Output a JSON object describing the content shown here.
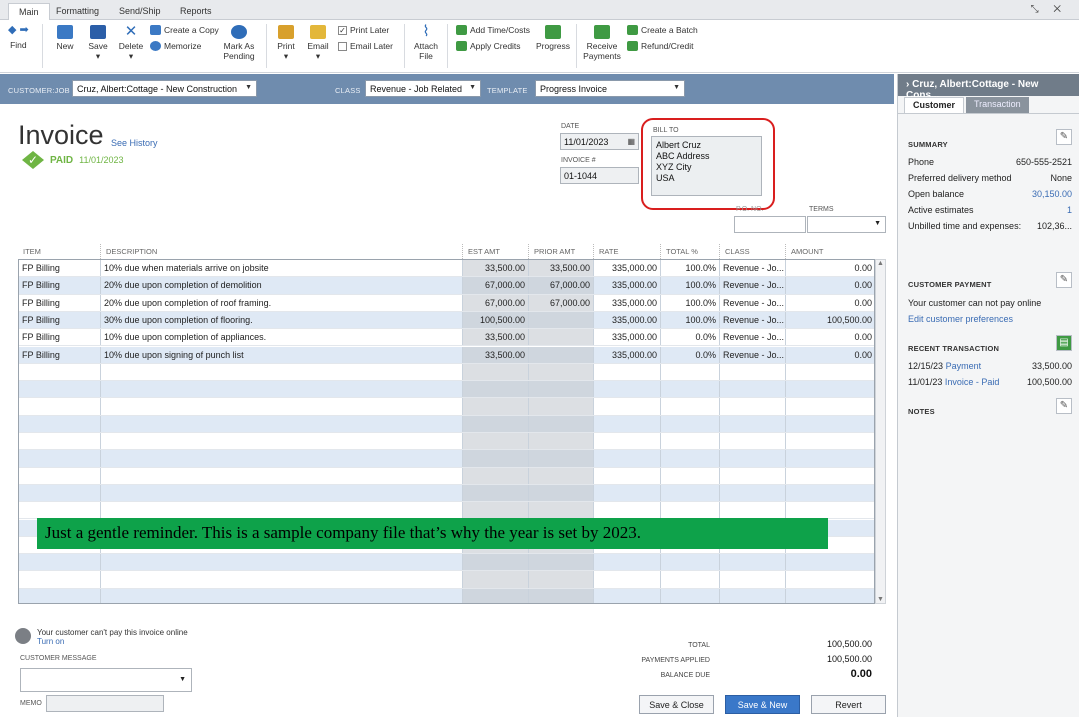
{
  "menu_tabs": [
    "Main",
    "Formatting",
    "Send/Ship",
    "Reports"
  ],
  "window_controls": "⤡ ✕",
  "toolbar": {
    "find": "Find",
    "new": "New",
    "save": "Save",
    "delete": "Delete",
    "create_copy": "Create a Copy",
    "memorize": "Memorize",
    "mark_pending": "Mark As Pending",
    "print": "Print",
    "email": "Email",
    "print_later": "Print Later",
    "email_later": "Email Later",
    "attach_file": "Attach File",
    "add_time_costs": "Add Time/Costs",
    "apply_credits": "Apply Credits",
    "progress": "Progress",
    "receive_payments": "Receive Payments",
    "create_batch": "Create a Batch",
    "refund_credit": "Refund/Credit"
  },
  "header": {
    "customer_job_label": "CUSTOMER:JOB",
    "customer_job": "Cruz, Albert:Cottage - New Construction",
    "class_label": "CLASS",
    "class": "Revenue - Job Related",
    "template_label": "TEMPLATE",
    "template": "Progress Invoice"
  },
  "invoice": {
    "title": "Invoice",
    "see_history": "See History",
    "paid_label": "PAID",
    "paid_date": "11/01/2023",
    "date_label": "DATE",
    "date": "11/01/2023",
    "invoice_no_label": "INVOICE #",
    "invoice_no": "01-1044",
    "bill_to_label": "BILL TO",
    "bill_to": [
      "Albert Cruz",
      "ABC Address",
      "XYZ City",
      "USA"
    ],
    "po_label": "P.O. NO.",
    "terms_label": "TERMS"
  },
  "grid": {
    "headers": [
      "ITEM",
      "DESCRIPTION",
      "EST AMT",
      "PRIOR AMT",
      "RATE",
      "TOTAL %",
      "CLASS",
      "AMOUNT"
    ],
    "rows": [
      [
        "FP Billing",
        "10% due when materials arrive on jobsite",
        "33,500.00",
        "33,500.00",
        "335,000.00",
        "100.0%",
        "Revenue - Jo...",
        "0.00"
      ],
      [
        "FP Billing",
        "20% due upon completion of demolition",
        "67,000.00",
        "67,000.00",
        "335,000.00",
        "100.0%",
        "Revenue - Jo...",
        "0.00"
      ],
      [
        "FP Billing",
        "20% due upon completion of roof framing.",
        "67,000.00",
        "67,000.00",
        "335,000.00",
        "100.0%",
        "Revenue - Jo...",
        "0.00"
      ],
      [
        "FP Billing",
        "30% due upon completion of flooring.",
        "100,500.00",
        "",
        "335,000.00",
        "100.0%",
        "Revenue - Jo...",
        "100,500.00"
      ],
      [
        "FP Billing",
        "10% due upon completion of appliances.",
        "33,500.00",
        "",
        "335,000.00",
        "0.0%",
        "Revenue - Jo...",
        "0.00"
      ],
      [
        "FP Billing",
        "10% due upon signing of punch list",
        "33,500.00",
        "",
        "335,000.00",
        "0.0%",
        "Revenue - Jo...",
        "0.00"
      ]
    ]
  },
  "note": "Just a gentle reminder. This is a sample company file that’s why the year is set by 2023.",
  "bottom": {
    "online_text": "Your customer can't pay this invoice online",
    "turn_on": "Turn on",
    "customer_message_label": "CUSTOMER MESSAGE",
    "memo_label": "MEMO",
    "total_label": "TOTAL",
    "total": "100,500.00",
    "payments_applied_label": "PAYMENTS APPLIED",
    "payments_applied": "100,500.00",
    "balance_due_label": "BALANCE DUE",
    "balance_due": "0.00",
    "save_close": "Save & Close",
    "save_new": "Save & New",
    "revert": "Revert"
  },
  "panel": {
    "title": "Cruz, Albert:Cottage - New Cons...",
    "tab_customer": "Customer",
    "tab_transaction": "Transaction",
    "summary_label": "SUMMARY",
    "summary": [
      {
        "label": "Phone",
        "value": "650-555-2521"
      },
      {
        "label": "Preferred delivery method",
        "value": "None"
      },
      {
        "label": "Open balance",
        "value": "30,150.00"
      },
      {
        "label": "Active estimates",
        "value": "1"
      },
      {
        "label": "Unbilled time and expenses:",
        "value": "102,36..."
      }
    ],
    "customer_payment_label": "CUSTOMER PAYMENT",
    "payment_text": "Your customer can not pay online",
    "edit_prefs": "Edit customer preferences",
    "recent_label": "RECENT TRANSACTION",
    "recent": [
      {
        "date": "12/15/23",
        "type": "Payment",
        "amount": "33,500.00"
      },
      {
        "date": "11/01/23",
        "type": "Invoice - Paid",
        "amount": "100,500.00"
      }
    ],
    "notes_label": "NOTES"
  }
}
